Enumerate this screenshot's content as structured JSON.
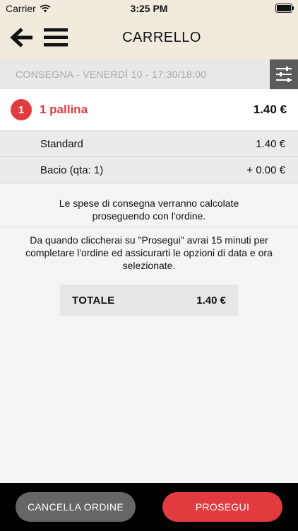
{
  "status_bar": {
    "carrier": "Carrier",
    "time": "3:25 PM"
  },
  "header": {
    "title": "CARRELLO",
    "back_icon": "arrow-left-icon",
    "menu_icon": "hamburger-menu-icon"
  },
  "delivery": {
    "text": "CONSEGNA - VENERDÌ 10 - 17:30/18:00",
    "filter_icon": "sliders-icon"
  },
  "cart": {
    "item": {
      "quantity": "1",
      "name": "1 pallina",
      "price": "1.40 €"
    },
    "options": [
      {
        "label": "Standard",
        "value": "1.40 €"
      },
      {
        "label": "Bacio (qta: 1)",
        "value": "+ 0.00 €"
      }
    ]
  },
  "info": {
    "delivery_note_line1": "Le spese di consegna verranno calcolate",
    "delivery_note_line2": "proseguendo con l'ordine.",
    "timer_note_line1": "Da quando cliccherai su \"Prosegui\" avrai 15 minuti per",
    "timer_note_line2": "completare l'ordine ed assicurarti le opzioni di data e ora",
    "timer_note_line3": "selezionate."
  },
  "total": {
    "label": "TOTALE",
    "value": "1.40 €"
  },
  "footer": {
    "cancel_label": "CANCELLA ORDINE",
    "next_label": "PROSEGUI"
  },
  "colors": {
    "accent": "#e23b3f",
    "header_bg": "#f1ebde",
    "cancel_button": "#666666"
  }
}
